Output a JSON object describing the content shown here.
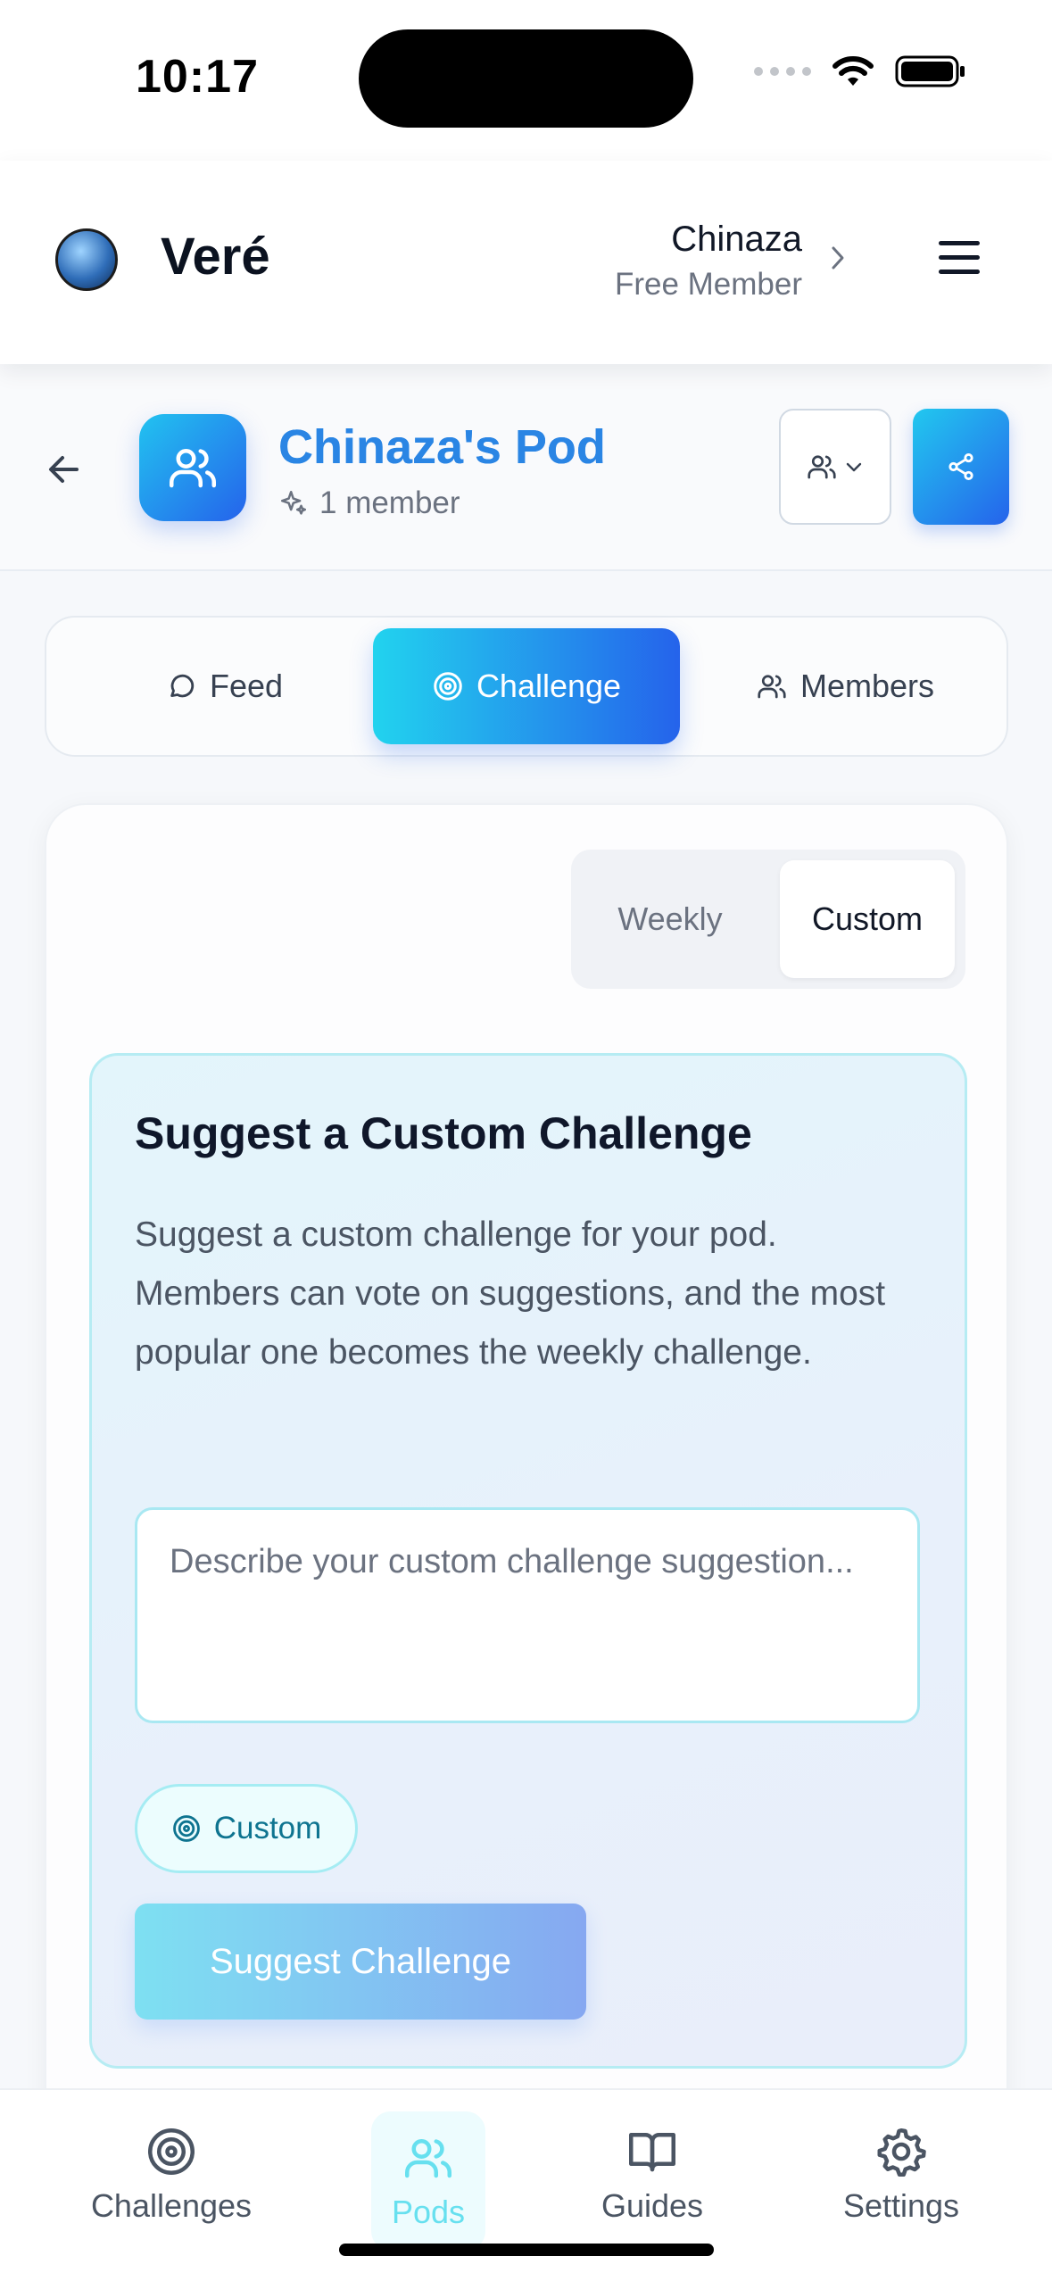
{
  "status_bar": {
    "time": "10:17"
  },
  "header": {
    "brand": "Veré",
    "user_name": "Chinaza",
    "user_tier": "Free Member"
  },
  "pod": {
    "title": "Chinaza's Pod",
    "member_count": "1 member"
  },
  "tabs": [
    {
      "label": "Feed",
      "icon": "chat-bubble-icon"
    },
    {
      "label": "Challenge",
      "icon": "target-icon",
      "active": true
    },
    {
      "label": "Members",
      "icon": "users-icon"
    }
  ],
  "mode_toggle": {
    "options": [
      "Weekly",
      "Custom"
    ],
    "selected": "Custom"
  },
  "suggest": {
    "title": "Suggest a Custom Challenge",
    "description": "Suggest a custom challenge for your pod. Members can vote on suggestions, and the most popular one becomes the weekly challenge.",
    "input_value": "",
    "input_placeholder": "Describe your custom challenge suggestion...",
    "chip_label": "Custom",
    "button_label": "Suggest Challenge"
  },
  "bottom_nav": [
    {
      "label": "Challenges",
      "icon": "target-icon"
    },
    {
      "label": "Pods",
      "icon": "users-icon",
      "active": true
    },
    {
      "label": "Guides",
      "icon": "book-icon"
    },
    {
      "label": "Settings",
      "icon": "gear-icon"
    }
  ],
  "colors": {
    "accent_start": "#22d3ee",
    "accent_end": "#2563eb",
    "pod_title": "#2a85e4"
  }
}
